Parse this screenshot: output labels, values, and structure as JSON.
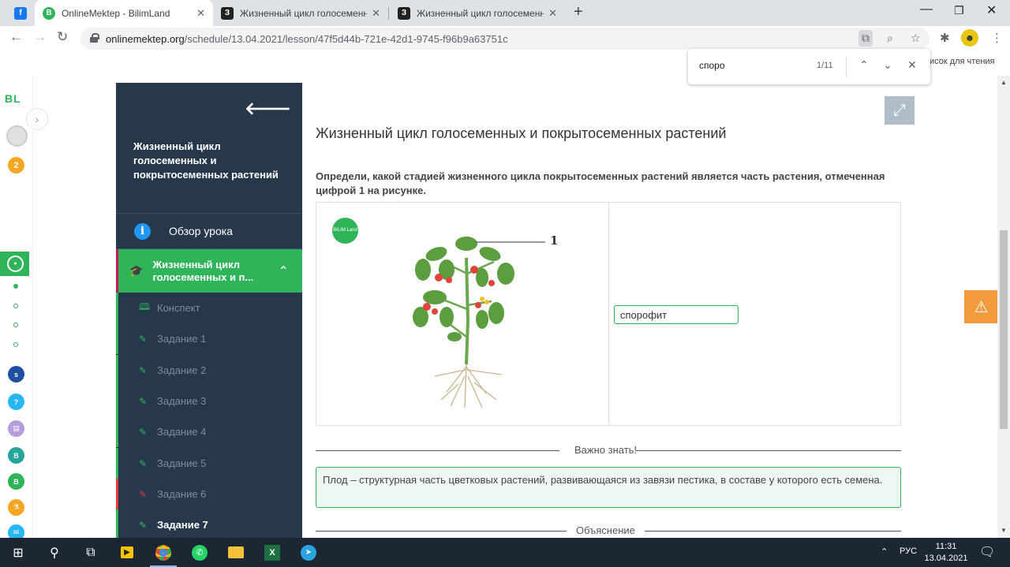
{
  "browser": {
    "tabs": [
      {
        "title": "OnlineMektep - BilimLand",
        "active": true
      },
      {
        "title": "Жизненный цикл голосеменных",
        "active": false
      },
      {
        "title": "Жизненный цикл голосеменных",
        "active": false
      }
    ],
    "url_domain": "onlinemektep.org",
    "url_path": "/schedule/13.04.2021/lesson/47f5d44b-721e-42d1-9745-f96b9a63751c",
    "reading_list": "писок для чтения"
  },
  "find": {
    "query": "споро",
    "count": "1/11"
  },
  "rail": {
    "logo": "BL",
    "badge": "2"
  },
  "sidebar": {
    "lesson_title": "Жизненный цикл голосеменных и покрытосеменных растений",
    "overview": "Обзор урока",
    "topic": "Жизненный цикл голосеменных и п...",
    "items": [
      {
        "label": "Конспект",
        "status": "done"
      },
      {
        "label": "Задание 1",
        "status": "done"
      },
      {
        "label": "Задание 2",
        "status": "done"
      },
      {
        "label": "Задание 3",
        "status": "done"
      },
      {
        "label": "Задание 4",
        "status": "done"
      },
      {
        "label": "Задание 5",
        "status": "done"
      },
      {
        "label": "Задание 6",
        "status": "wrong"
      },
      {
        "label": "Задание 7",
        "status": "current"
      }
    ]
  },
  "main": {
    "title": "Жизненный цикл голосеменных и покрытосеменных растений",
    "question": "Определи, какой стадией жизненного цикла покрытосеменных растений является часть растения, отмеченная цифрой 1 на рисунке.",
    "figure_marker": "1",
    "figure_badge": "BILIM Land",
    "answer_value": "спорофит",
    "important_label": "Важно знать!",
    "important_text": "Плод – структурная часть цветковых растений, развивающаяся из завязи пестика, в составе у которого есть семена.",
    "explanation_label": "Объяснение"
  },
  "taskbar": {
    "language": "РУС",
    "time": "11:31",
    "date": "13.04.2021"
  },
  "colors": {
    "accent_green": "#2fb45a",
    "sidebar_bg": "#27384d",
    "warning": "#f39c3d"
  }
}
